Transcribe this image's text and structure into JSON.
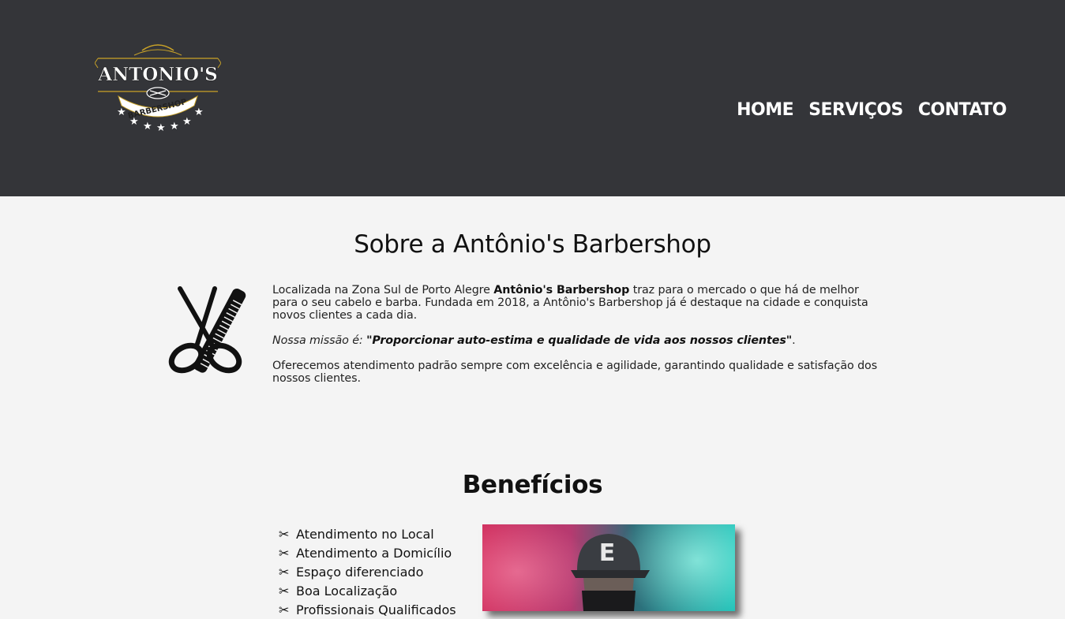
{
  "header": {
    "logo": {
      "top_text": "ANTONIO'S",
      "ribbon_text": "BARBERSHOP",
      "brand_color": "#c9a227",
      "icon": "scissors-razor-emblem-icon"
    },
    "nav": [
      {
        "label": "HOME"
      },
      {
        "label": "SERVIÇOS"
      },
      {
        "label": "CONTATO"
      }
    ],
    "background": "#343539"
  },
  "about": {
    "title": "Sobre a Antônio's Barbershop",
    "icon": "scissors-comb-icon",
    "p1_before": "Localizada na Zona Sul de Porto Alegre ",
    "p1_brand": "Antônio's Barbershop",
    "p1_after": " traz para o mercado o que há de melhor para o seu cabelo e barba. Fundada em 2018, a Antônio's Barbershop já é destaque na cidade e conquista novos clientes a cada dia.",
    "mission_label": "Nossa missão é: ",
    "mission_quote": "\"Proporcionar auto-estima e qualidade de vida aos nossos clientes\"",
    "mission_end": ".",
    "p3": "Oferecemos atendimento padrão sempre com excelência e agilidade, garantindo qualidade e satisfação dos nossos clientes."
  },
  "benefits": {
    "title": "Benefícios",
    "bullet_icon": "scissors-icon",
    "items": [
      {
        "label": "Atendimento no Local"
      },
      {
        "label": "Atendimento a Domicílio"
      },
      {
        "label": "Espaço diferenciado"
      },
      {
        "label": "Boa Localização"
      },
      {
        "label": "Profissionais Qualificados"
      }
    ],
    "image": {
      "cap_letter": "E",
      "colors": [
        "#d1305f",
        "#19c0b6"
      ]
    }
  }
}
